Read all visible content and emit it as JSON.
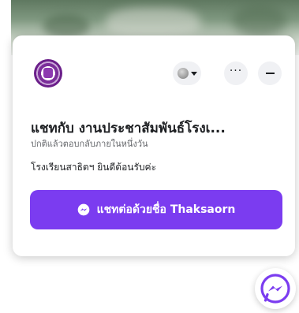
{
  "chat": {
    "title": "แชทกับ งานประชาสัมพันธ์โรงเ...",
    "subtitle": "ปกติแล้วตอบกลับภายในหนึ่งวัน",
    "greeting": "โรงเรียนสาธิตฯ ยินดีต้อนรับค่ะ",
    "cta_label": "แชทต่อด้วยชื่อ Thaksaorn",
    "more_label": "···"
  },
  "colors": {
    "accent": "#7b3cf0",
    "logo": "#7b2e9a"
  },
  "icons": {
    "header_more": "more-icon",
    "header_minimize": "minimize-icon",
    "cta_icon": "messenger-icon",
    "fab_icon": "messenger-icon"
  }
}
